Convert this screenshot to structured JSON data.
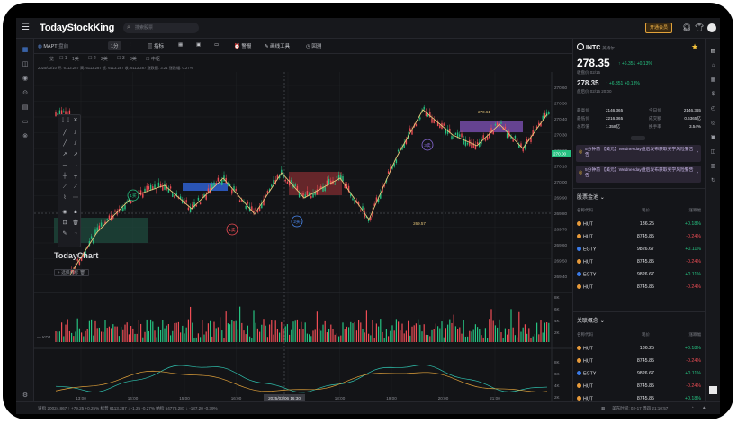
{
  "topbar": {
    "logo": "TodayStockKing",
    "search_placeholder": "搜索股票",
    "member_button": "开通会员"
  },
  "toolbar": {
    "symbol": "MAPT",
    "symbol_note": "盘前",
    "interval": "1分",
    "items": [
      "指标",
      "警报",
      "画线工具",
      "回测"
    ]
  },
  "subbar": {
    "items": [
      "一览",
      "1",
      "1美",
      "2",
      "2美",
      "3",
      "3美",
      "中枢"
    ]
  },
  "infobar": {
    "text": "2025/03/10   开: 6113.287   高: 6113.287   低: 6113.287   收: 6113.287   涨跌额: 3.21   涨跌幅: 0.27%"
  },
  "chart": {
    "watermark": "TodayChart",
    "indicator_label": "+ 选择指标",
    "kdj_label": "KDJ",
    "price_axis": [
      "270.60",
      "270.50",
      "270.40",
      "270.30",
      "270.20",
      "270.10",
      "270.00",
      "269.90",
      "269.80",
      "269.70",
      "269.60",
      "269.50",
      "269.40"
    ],
    "vol_axis": [
      "8K",
      "6K",
      "4K",
      "2K"
    ],
    "kdj_axis": [
      "8K",
      "6K",
      "4K",
      "2K"
    ],
    "time_axis": [
      "13:00",
      "14:00",
      "15:00",
      "16:00",
      "17:00",
      "18:00",
      "19:00",
      "20:00",
      "21:00"
    ],
    "crosshair_time": "2025/03/06 16:30",
    "crosshair_price": "270.00",
    "markers": [
      {
        "label": "1买",
        "type": "buy"
      },
      {
        "label": "1卖",
        "type": "sell"
      },
      {
        "label": "2买",
        "type": "buy"
      },
      {
        "label": "3卖",
        "type": "sell"
      },
      {
        "label": "3卖",
        "type": "sell2"
      }
    ],
    "annotations": [
      "270.61",
      "269.57"
    ]
  },
  "quote": {
    "symbol": "INTC",
    "name": "英特尔",
    "price": "278.35",
    "change": "+6.351",
    "pct": "+0.13%",
    "time1": "收盘价 02/16",
    "after_price": "278.35",
    "after_change": "+6.351",
    "after_pct": "+0.13%",
    "time2": "盘后价 02/16 20:00",
    "stats": [
      [
        "最高价",
        "2146.365",
        "今日价",
        "2146.365"
      ],
      [
        "最低价",
        "2216.365",
        "成交额",
        "0.6365亿"
      ],
      [
        "总市值",
        "1.358亿",
        "换手率",
        "3.54%"
      ]
    ],
    "news": [
      "5分钟前 【美元】Wednesday盘后发布获取奖学风险警告告",
      "5分钟前 【美元】Wednesday盘后发布获取奖学风险警告告"
    ]
  },
  "pool": {
    "title": "股票金池",
    "headers": [
      "名称代码",
      "现价",
      "涨跌幅"
    ],
    "rows": [
      {
        "name": "HUT",
        "price": "136.25",
        "pct": "+0.18%",
        "up": true
      },
      {
        "name": "HUT",
        "price": "8745.85",
        "pct": "-0.24%",
        "up": false
      },
      {
        "name": "EGTY",
        "price": "9826.67",
        "pct": "+0.11%",
        "up": true
      },
      {
        "name": "HUT",
        "price": "8745.85",
        "pct": "-0.24%",
        "up": false
      },
      {
        "name": "EGTY",
        "price": "9826.67",
        "pct": "+0.11%",
        "up": true
      },
      {
        "name": "HUT",
        "price": "8745.85",
        "pct": "-0.24%",
        "up": false
      }
    ]
  },
  "related": {
    "title": "关联概念",
    "headers": [
      "名称代码",
      "现价",
      "涨跌幅"
    ],
    "rows": [
      {
        "name": "HUT",
        "price": "136.25",
        "pct": "+0.18%",
        "up": true
      },
      {
        "name": "HUT",
        "price": "8745.85",
        "pct": "-0.24%",
        "up": false
      },
      {
        "name": "EGTY",
        "price": "9826.67",
        "pct": "+0.11%",
        "up": true
      },
      {
        "name": "HUT",
        "price": "8745.85",
        "pct": "-0.24%",
        "up": false
      },
      {
        "name": "HUT",
        "price": "8745.85",
        "pct": "+0.18%",
        "up": true
      }
    ]
  },
  "status": {
    "left": "道指  20024.867 ↑  +79.25  +0.25%      标普  6113.287 ↓  -1.25  -0.27%      纳指  54778.287 ↓  -187.20  -0.39%",
    "right": "美东时间: 02-17  周四  21:10:57"
  },
  "colors": {
    "up": "#26c281",
    "down": "#ef4d55",
    "accent": "#f2b54a",
    "zigzag": "#e7c77a",
    "purple": "#7b4fb0"
  }
}
